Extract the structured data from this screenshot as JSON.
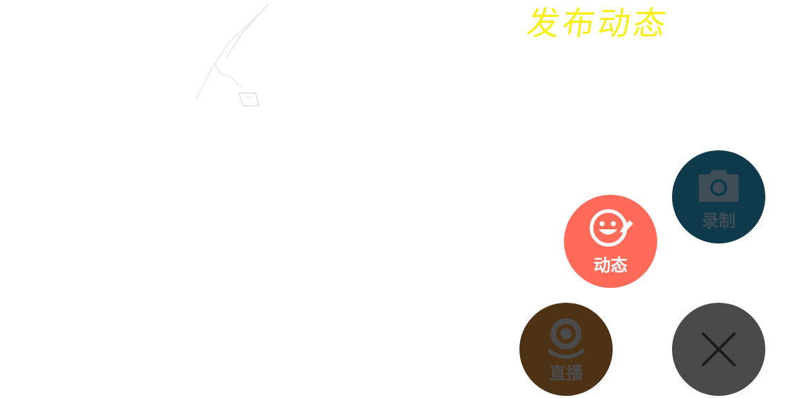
{
  "header": {
    "title": "发布动态"
  },
  "actions": {
    "record": {
      "label": "录制",
      "icon": "camera-icon",
      "color": "#0e3a4c"
    },
    "post": {
      "label": "动态",
      "icon": "smiley-pen-icon",
      "color": "#ff6b58"
    },
    "live": {
      "label": "直播",
      "icon": "webcam-icon",
      "color": "#4e3216"
    },
    "close": {
      "icon": "close-icon",
      "color": "#4a4a4a"
    }
  },
  "colors": {
    "title": "#f7ef1c",
    "background": "#ffffff"
  }
}
